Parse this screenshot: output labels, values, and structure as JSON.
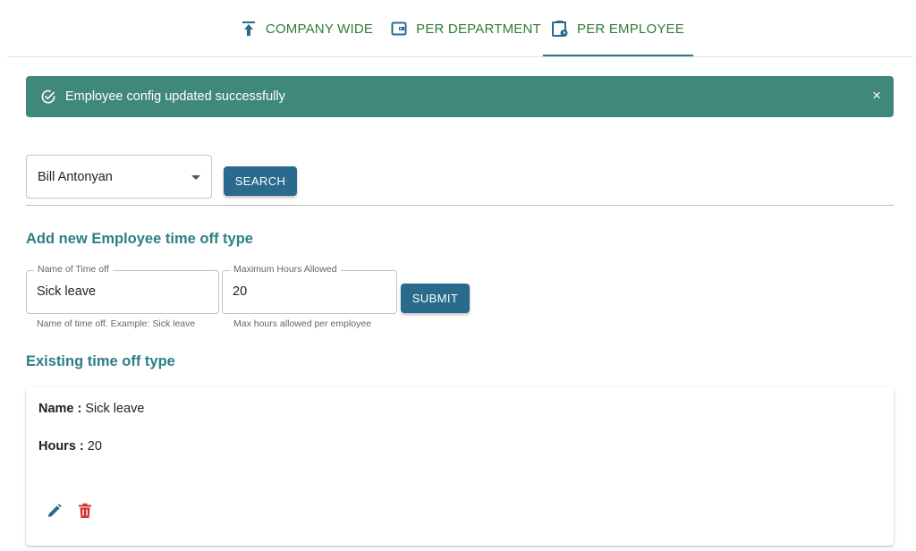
{
  "tabs": [
    {
      "label": "COMPANY WIDE",
      "icon": "upload-icon"
    },
    {
      "label": "PER DEPARTMENT",
      "icon": "wallet-icon"
    },
    {
      "label": "PER EMPLOYEE",
      "icon": "clipboard-clock-icon"
    }
  ],
  "active_tab": "PER EMPLOYEE",
  "alert": {
    "message": "Employee config updated successfully",
    "close_label": "×",
    "icon": "check-circle-icon"
  },
  "employee_select": {
    "value": "Bill Antonyan"
  },
  "search_button": "SEARCH",
  "add_section": {
    "title": "Add new Employee time off type",
    "name_field": {
      "label": "Name of Time off",
      "value": "Sick leave",
      "helper": "Name of time off. Example: Sick leave"
    },
    "hours_field": {
      "label": "Maximum Hours Allowed",
      "value": "20",
      "helper": "Max hours allowed per employee"
    },
    "submit_button": "SUBMIT"
  },
  "existing_section": {
    "title": "Existing time off type",
    "items": [
      {
        "name_label": "Name :",
        "name": "Sick leave",
        "hours_label": "Hours :",
        "hours": "20"
      }
    ]
  },
  "colors": {
    "tab_text": "#2e7d32",
    "indicator": "#2f6f8f",
    "alert_bg": "#40887b",
    "button_bg": "#2a6a8c",
    "section_title": "#2b7f87",
    "edit_icon": "#2a6a8c",
    "delete_icon": "#d32f2f"
  }
}
